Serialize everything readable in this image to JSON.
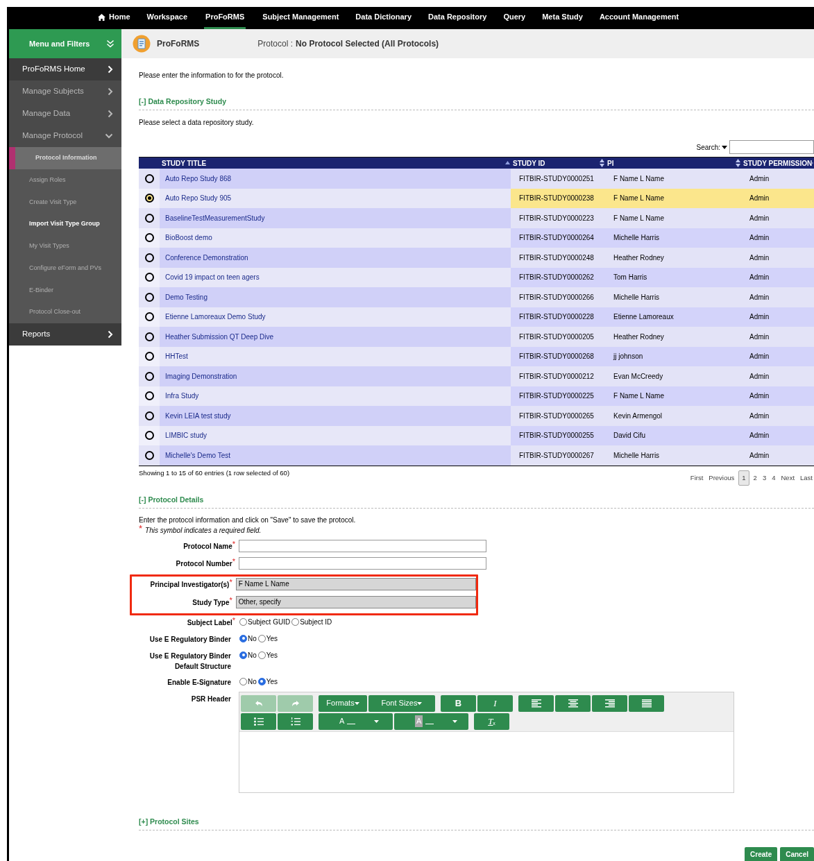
{
  "nav": [
    {
      "label": "Home",
      "kind": "home",
      "selected": false
    },
    {
      "label": "Workspace",
      "kind": "link",
      "selected": false
    },
    {
      "label": "ProFoRMS",
      "kind": "link",
      "selected": true
    },
    {
      "label": "Subject Management",
      "kind": "link",
      "selected": false
    },
    {
      "label": "Data Dictionary",
      "kind": "link",
      "selected": false
    },
    {
      "label": "Data Repository",
      "kind": "link",
      "selected": false
    },
    {
      "label": "Query",
      "kind": "link",
      "selected": false
    },
    {
      "label": "Meta Study",
      "kind": "link",
      "selected": false
    },
    {
      "label": "Account Management",
      "kind": "link",
      "selected": false
    }
  ],
  "sidebar": {
    "title": "Menu and Filters",
    "items": [
      {
        "label": "ProFoRMS Home",
        "disabled": false,
        "expanded": false
      },
      {
        "label": "Manage Subjects",
        "disabled": true,
        "expanded": false
      },
      {
        "label": "Manage Data",
        "disabled": true,
        "expanded": false
      },
      {
        "label": "Manage Protocol",
        "disabled": true,
        "expanded": true,
        "children": [
          {
            "label": "Protocol Information",
            "selected": true,
            "disabled": true
          },
          {
            "label": "Assign Roles",
            "selected": false,
            "disabled": true
          },
          {
            "label": "Create Visit Type",
            "selected": false,
            "disabled": true
          },
          {
            "label": "Import Visit Type Group",
            "selected": false,
            "disabled": false
          },
          {
            "label": "My Visit Types",
            "selected": false,
            "disabled": true
          },
          {
            "label": "Configure eForm and PVs",
            "selected": false,
            "disabled": true
          },
          {
            "label": "E-Binder",
            "selected": false,
            "disabled": true
          },
          {
            "label": "Protocol Close-out",
            "selected": false,
            "disabled": true
          }
        ]
      },
      {
        "label": "Reports",
        "disabled": false,
        "expanded": false
      }
    ]
  },
  "header": {
    "app": "ProFoRMS",
    "protocol_label": "Protocol :",
    "protocol_value": "No Protocol Selected (All Protocols)"
  },
  "intro": "Please enter the information to for the protocol.",
  "repo_section": {
    "heading": "[-] Data Repository Study",
    "text": "Please select a data repository study.",
    "search_label": "Search:",
    "columns": [
      {
        "label": "STUDY TITLE",
        "sorted": true
      },
      {
        "label": "STUDY ID",
        "sorted": false
      },
      {
        "label": "PI",
        "sorted": false
      },
      {
        "label": "STUDY PERMISSION",
        "sorted": false
      }
    ],
    "rows": [
      {
        "selected": false,
        "cells": [
          "Auto Repo Study 868",
          "FITBIR-STUDY0000251",
          "F Name L Name",
          "Admin"
        ]
      },
      {
        "selected": true,
        "cells": [
          "Auto Repo Study 905",
          "FITBIR-STUDY0000238",
          "F Name L Name",
          "Admin"
        ]
      },
      {
        "selected": false,
        "cells": [
          "BaselineTestMeasurementStudy",
          "FITBIR-STUDY0000223",
          "F Name L Name",
          "Admin"
        ]
      },
      {
        "selected": false,
        "cells": [
          "BioBoost demo",
          "FITBIR-STUDY0000264",
          "Michelle Harris",
          "Admin"
        ]
      },
      {
        "selected": false,
        "cells": [
          "Conference Demonstration",
          "FITBIR-STUDY0000248",
          "Heather Rodney",
          "Admin"
        ]
      },
      {
        "selected": false,
        "cells": [
          "Covid 19 impact on teen agers",
          "FITBIR-STUDY0000262",
          "Tom Harris",
          "Admin"
        ]
      },
      {
        "selected": false,
        "cells": [
          "Demo Testing",
          "FITBIR-STUDY0000266",
          "Michelle Harris",
          "Admin"
        ]
      },
      {
        "selected": false,
        "cells": [
          "Etienne Lamoreaux Demo Study",
          "FITBIR-STUDY0000228",
          "Etienne Lamoreaux",
          "Admin"
        ]
      },
      {
        "selected": false,
        "cells": [
          "Heather Submission QT Deep Dive",
          "FITBIR-STUDY0000205",
          "Heather Rodney",
          "Admin"
        ]
      },
      {
        "selected": false,
        "cells": [
          "HHTest",
          "FITBIR-STUDY0000268",
          "jj johnson",
          "Admin"
        ]
      },
      {
        "selected": false,
        "cells": [
          "Imaging Demonstration",
          "FITBIR-STUDY0000212",
          "Evan McCreedy",
          "Admin"
        ]
      },
      {
        "selected": false,
        "cells": [
          "Infra Study",
          "FITBIR-STUDY0000225",
          "F Name L Name",
          "Admin"
        ]
      },
      {
        "selected": false,
        "cells": [
          "Kevin LEIA test study",
          "FITBIR-STUDY0000265",
          "Kevin Armengol",
          "Admin"
        ]
      },
      {
        "selected": false,
        "cells": [
          "LIMBIC study",
          "FITBIR-STUDY0000255",
          "David Cifu",
          "Admin"
        ]
      },
      {
        "selected": false,
        "cells": [
          "Michelle's Demo Test",
          "FITBIR-STUDY0000267",
          "Michelle Harris",
          "Admin"
        ]
      }
    ],
    "info": "Showing 1 to 15 of 60 entries (1 row selected of 60)",
    "pagination": [
      {
        "label": "First",
        "selected": false
      },
      {
        "label": "Previous",
        "selected": false
      },
      {
        "label": "1",
        "selected": true
      },
      {
        "label": "2",
        "selected": false
      },
      {
        "label": "3",
        "selected": false
      },
      {
        "label": "4",
        "selected": false
      },
      {
        "label": "Next",
        "selected": false
      },
      {
        "label": "Last",
        "selected": false
      }
    ]
  },
  "details_section": {
    "heading": "[-] Protocol Details",
    "text": "Enter the protocol information and click on \"Save\" to save the protocol.",
    "required_mark": "*",
    "required_note": "This symbol indicates a required field.",
    "fields": [
      {
        "kind": "text",
        "label": "Protocol Name",
        "required": true,
        "highlighted": false
      },
      {
        "kind": "text",
        "label": "Protocol Number",
        "required": true,
        "highlighted": false
      },
      {
        "kind": "readonly",
        "label": "Principal Investigator(s)",
        "required": true,
        "value": "F Name L Name",
        "highlighted": true
      },
      {
        "kind": "readonly",
        "label": "Study Type",
        "required": true,
        "value": "Other, specify",
        "highlighted": true
      },
      {
        "kind": "radio",
        "label": "Subject Label",
        "required": true,
        "options": [
          {
            "label": "Subject GUID",
            "selected": false
          },
          {
            "label": "Subject ID",
            "selected": false
          }
        ]
      },
      {
        "kind": "radio",
        "label": "Use E Regulatory Binder",
        "required": false,
        "options": [
          {
            "label": "No",
            "selected": true
          },
          {
            "label": "Yes",
            "selected": false
          }
        ]
      },
      {
        "kind": "radio",
        "label": "Use E Regulatory Binder Default Structure",
        "required": false,
        "options": [
          {
            "label": "No",
            "selected": true
          },
          {
            "label": "Yes",
            "selected": false
          }
        ]
      },
      {
        "kind": "radio",
        "label": "Enable E-Signature",
        "required": false,
        "options": [
          {
            "label": "No",
            "selected": false
          },
          {
            "label": "Yes",
            "selected": true
          }
        ]
      },
      {
        "kind": "editor",
        "label": "PSR Header",
        "required": false,
        "toolbar": [
          [
            {
              "kind": "undo",
              "disabled": true
            },
            {
              "kind": "redo",
              "disabled": true
            },
            {
              "kind": "dropdown",
              "label": "Formats",
              "disabled": false
            },
            {
              "kind": "dropdown",
              "label": "Font Sizes",
              "disabled": false
            },
            {
              "kind": "bold",
              "label": "B",
              "disabled": false
            },
            {
              "kind": "italic",
              "label": "I",
              "disabled": false
            },
            {
              "kind": "align-left",
              "disabled": false
            },
            {
              "kind": "align-center",
              "disabled": false
            },
            {
              "kind": "align-right",
              "disabled": false
            },
            {
              "kind": "justify",
              "disabled": false
            }
          ],
          [
            {
              "kind": "bullets",
              "disabled": false
            },
            {
              "kind": "numbers",
              "disabled": false
            },
            {
              "kind": "text-color",
              "label": "A",
              "disabled": false
            },
            {
              "kind": "bg-color",
              "label": "A",
              "disabled": false
            },
            {
              "kind": "clear",
              "label": "T",
              "sub": "x",
              "disabled": false
            }
          ]
        ]
      }
    ]
  },
  "sites_section": {
    "heading": "[+] Protocol Sites"
  },
  "buttons": [
    {
      "label": "Create"
    },
    {
      "label": "Cancel"
    }
  ]
}
